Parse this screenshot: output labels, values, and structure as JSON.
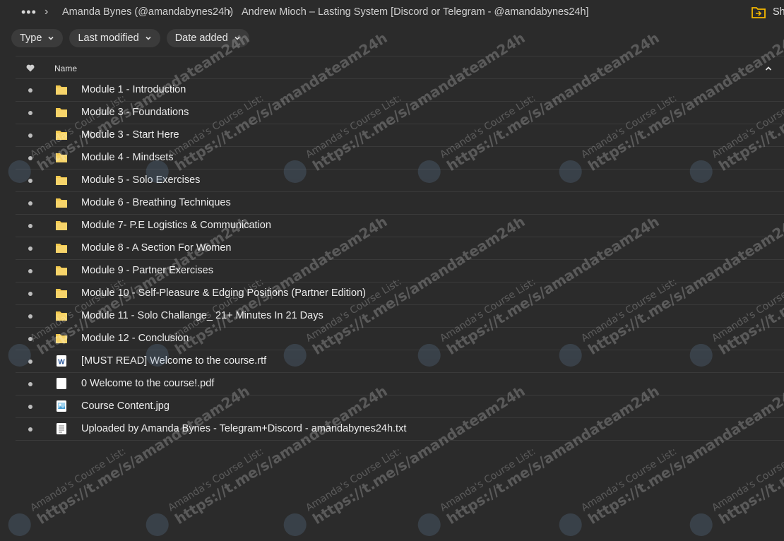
{
  "breadcrumb": {
    "more": "•••",
    "items": [
      "Amanda Bynes (@amandabynes24h)",
      "Andrew Mioch – Lasting System [Discord or Telegram - @amandabynes24h]"
    ]
  },
  "toolbar": {
    "share_label": "Sh"
  },
  "filters": [
    "Type",
    "Last modified",
    "Date added"
  ],
  "list": {
    "header_name": "Name",
    "rows": [
      {
        "name": "Module 1 - Introduction",
        "icon": "folder-icon"
      },
      {
        "name": "Module 3 - Foundations",
        "icon": "folder-icon"
      },
      {
        "name": "Module 3 - Start Here",
        "icon": "folder-icon"
      },
      {
        "name": "Module 4 - Mindsets",
        "icon": "folder-icon"
      },
      {
        "name": "Module 5 - Solo Exercises",
        "icon": "folder-icon"
      },
      {
        "name": "Module 6 - Breathing Techniques",
        "icon": "folder-icon"
      },
      {
        "name": "Module 7- P.E Logistics & Communication",
        "icon": "folder-icon"
      },
      {
        "name": "Module 8 - A Section For Women",
        "icon": "folder-icon"
      },
      {
        "name": "Module 9 - Partner Exercises",
        "icon": "folder-icon"
      },
      {
        "name": "Module 10 - Self-Pleasure & Edging Positions (Partner Edition)",
        "icon": "folder-icon"
      },
      {
        "name": "Module 11 - Solo Challange_ 21+ Minutes In 21 Days",
        "icon": "folder-icon"
      },
      {
        "name": "Module 12 - Conclusion",
        "icon": "folder-icon"
      },
      {
        "name": "[MUST READ] Welcome to the course.rtf",
        "icon": "word-doc-icon"
      },
      {
        "name": "0 Welcome to the course!.pdf",
        "icon": "pdf-file-icon"
      },
      {
        "name": "Course Content.jpg",
        "icon": "image-file-icon"
      },
      {
        "name": "Uploaded by Amanda Bynes - Telegram+Discord - amandabynes24h.txt",
        "icon": "text-file-icon"
      }
    ]
  },
  "watermark": {
    "line1": "Amanda's Course List:",
    "line2": "https://t.me/s/amandateam24h"
  },
  "colors": {
    "background": "#2b2b2b",
    "folder": "#f3c94e",
    "accent_share": "#f5b800"
  }
}
